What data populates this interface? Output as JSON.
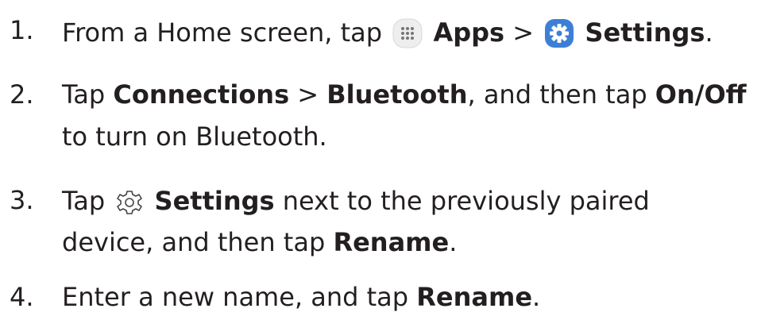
{
  "steps": [
    {
      "number": "1.",
      "parts": {
        "a": "From a Home screen, tap ",
        "apps_label": "Apps",
        "sep": " > ",
        "settings_label": "Settings",
        "end": "."
      },
      "icons": [
        "apps-grid-icon",
        "settings-app-icon"
      ]
    },
    {
      "number": "2.",
      "parts": {
        "a": "Tap ",
        "connections_label": "Connections",
        "sep": " > ",
        "bluetooth_label": "Bluetooth",
        "b": ", and then tap ",
        "onoff_label": "On/Off",
        "line2": "to turn on Bluetooth."
      }
    },
    {
      "number": "3.",
      "parts": {
        "a": "Tap ",
        "settings_label": "Settings",
        "b": " next to the previously paired",
        "line2_a": "device, and then tap ",
        "rename_label": "Rename",
        "end": "."
      },
      "icons": [
        "gear-outline-icon"
      ]
    },
    {
      "number": "4.",
      "parts": {
        "a": "Enter a new name, and tap ",
        "rename_label": "Rename",
        "end": "."
      }
    }
  ],
  "colors": {
    "text": "#231f20",
    "settings_icon_bg": "#3d7fd6",
    "apps_icon_bg": "#eeeeee",
    "apps_icon_dots": "#777777"
  }
}
